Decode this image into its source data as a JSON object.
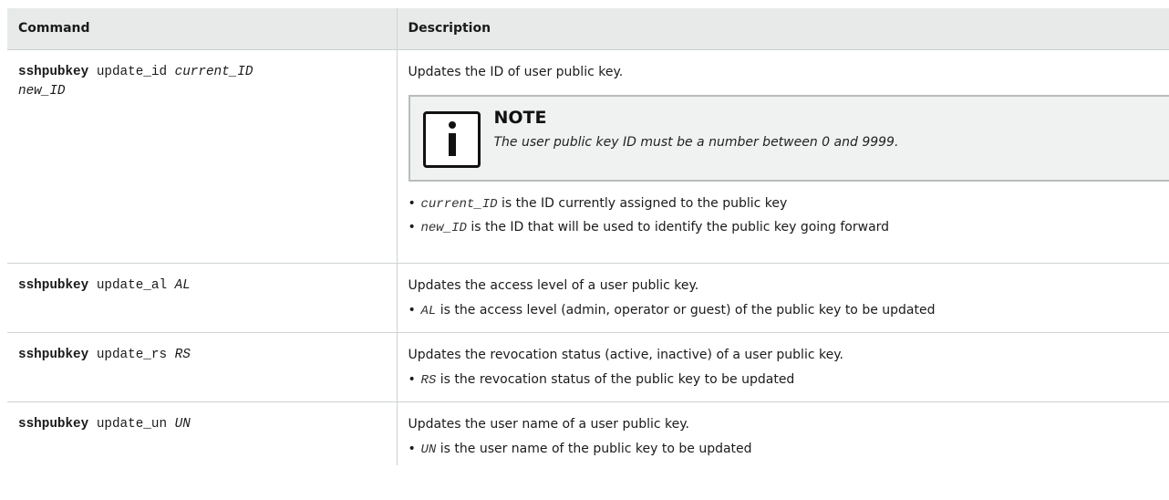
{
  "table": {
    "headers": {
      "command": "Command",
      "description": "Description"
    },
    "rows": [
      {
        "cmd_keyword": "sshpubkey",
        "cmd_sub": "update_id",
        "cmd_arg": "current_ID",
        "cmd_arg2": "new_ID",
        "desc": "Updates the ID of user public key.",
        "note": {
          "title": "NOTE",
          "text": "The user public key ID must be a number between 0 and 9999."
        },
        "bullets": [
          {
            "arg": "current_ID",
            "text": " is the ID currently assigned to the public key"
          },
          {
            "arg": "new_ID",
            "text": " is the ID that will be used to identify the public key going forward"
          }
        ]
      },
      {
        "cmd_keyword": "sshpubkey",
        "cmd_sub": "update_al",
        "cmd_arg": "AL",
        "desc": "Updates the access level of a user public key.",
        "bullets": [
          {
            "arg": "AL",
            "text": " is the access level (admin, operator or guest) of the public key to be updated"
          }
        ]
      },
      {
        "cmd_keyword": "sshpubkey",
        "cmd_sub": "update_rs",
        "cmd_arg": "RS",
        "desc": "Updates the revocation status (active, inactive) of a user public key.",
        "bullets": [
          {
            "arg": "RS",
            "text": " is the revocation status of the public key to be updated"
          }
        ]
      },
      {
        "cmd_keyword": "sshpubkey",
        "cmd_sub": "update_un",
        "cmd_arg": "UN",
        "desc": "Updates the user name of a user public key.",
        "bullets": [
          {
            "arg": "UN",
            "text": " is the user name of the public key to be updated"
          }
        ]
      }
    ]
  }
}
